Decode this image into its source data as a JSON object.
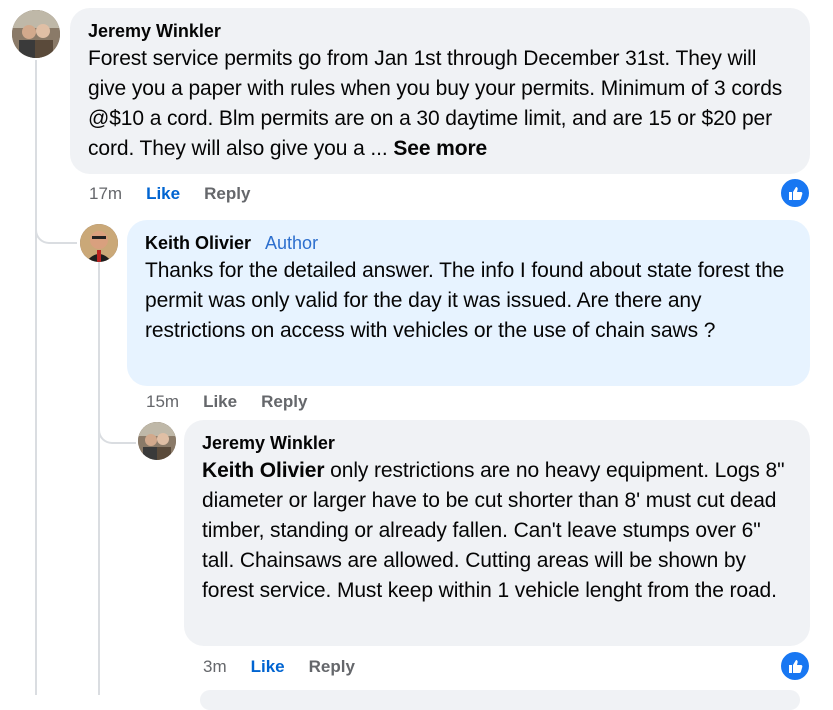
{
  "comments": [
    {
      "author": "Jeremy Winkler",
      "text": "Forest service permits go from Jan 1st through December 31st. They will give you a paper with rules when you buy your permits. Minimum of 3 cords @$10 a cord. Blm permits are on a 30 daytime limit, and are 15 or $20 per cord. They will also give you a ...",
      "see_more": "See more",
      "time": "17m",
      "like": "Like",
      "reply": "Reply",
      "reaction_icon": "thumbs-up-icon"
    },
    {
      "author": "Keith Olivier",
      "badge": "Author",
      "text": "Thanks for the detailed answer. The info I found about state forest the permit was only valid for the day it was issued. Are there any restrictions on access with vehicles or the use of chain saws ?",
      "time": "15m",
      "like": "Like",
      "reply": "Reply"
    },
    {
      "author": "Jeremy Winkler",
      "mention": "Keith Olivier",
      "text": "only restrictions are no heavy equipment. Logs 8\" diameter or larger have to be cut shorter than 8' must cut dead timber, standing or already fallen. Can't leave stumps over 6\" tall. Chainsaws are allowed. Cutting areas will be shown by forest service. Must keep within 1 vehicle lenght from the road.",
      "time": "3m",
      "like": "Like",
      "reply": "Reply",
      "reaction_icon": "thumbs-up-icon"
    }
  ],
  "colors": {
    "like_active": "#0064d1",
    "author_badge": "#2d6fce",
    "reaction_blue": "#1877f2",
    "bubble_gray": "#f0f2f5",
    "bubble_highlight": "#e7f3ff"
  }
}
